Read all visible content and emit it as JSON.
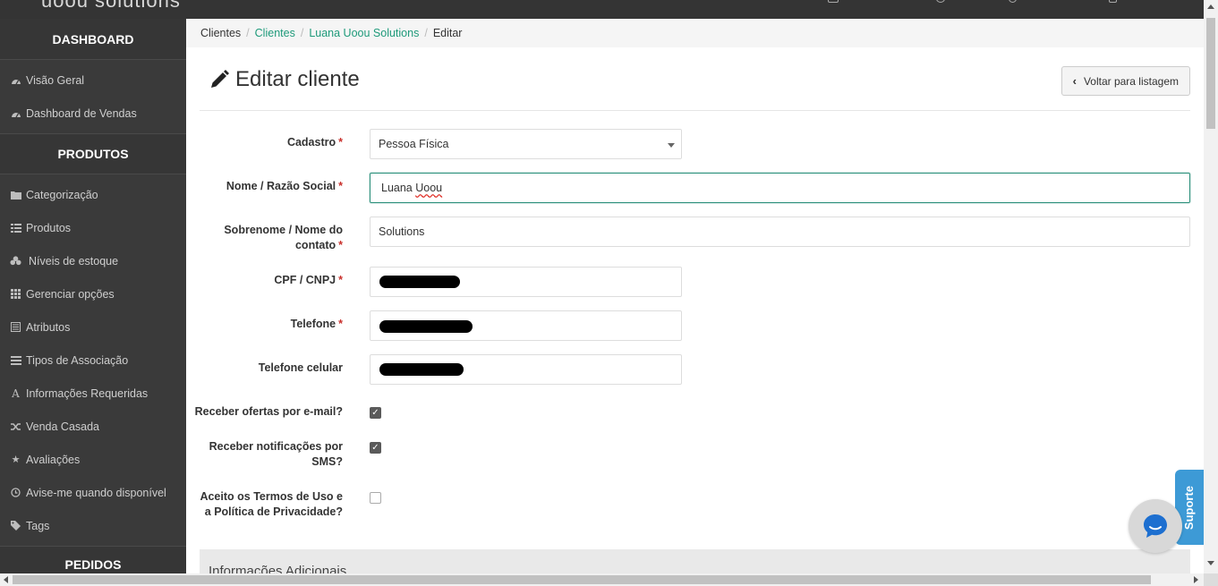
{
  "topbar": {
    "logo": "uoou solutions"
  },
  "sidebar": {
    "sections": {
      "dashboard": "DASHBOARD",
      "produtos": "PRODUTOS",
      "pedidos": "PEDIDOS"
    },
    "dashboard_items": [
      {
        "label": "Visão Geral",
        "icon": "dashboard-icon"
      },
      {
        "label": "Dashboard de Vendas",
        "icon": "dashboard-icon"
      }
    ],
    "produtos_items": [
      {
        "label": "Categorização",
        "icon": "folder-icon"
      },
      {
        "label": "Produtos",
        "icon": "list-icon"
      },
      {
        "label": "Níveis de estoque",
        "icon": "cubes-icon"
      },
      {
        "label": "Gerenciar opções",
        "icon": "grid-icon"
      },
      {
        "label": "Atributos",
        "icon": "list-alt-icon"
      },
      {
        "label": "Tipos de Associação",
        "icon": "list-icon"
      },
      {
        "label": "Informações Requeridas",
        "icon": "font-icon"
      },
      {
        "label": "Venda Casada",
        "icon": "shuffle-icon"
      },
      {
        "label": "Avaliações",
        "icon": "star-icon"
      },
      {
        "label": "Avise-me quando disponível",
        "icon": "clock-icon"
      },
      {
        "label": "Tags",
        "icon": "tag-icon"
      }
    ]
  },
  "breadcrumb": {
    "root": "Clientes",
    "link1": "Clientes",
    "link2": "Luana Uoou Solutions",
    "current": "Editar"
  },
  "page": {
    "title": "Editar cliente",
    "back_label": "Voltar para listagem"
  },
  "form": {
    "cadastro": {
      "label": "Cadastro",
      "value": "Pessoa Física"
    },
    "nome": {
      "label": "Nome / Razão Social",
      "value_first": "Luana",
      "value_second": "Uoou"
    },
    "sobrenome": {
      "label_line1": "Sobrenome / Nome do",
      "label_line2": "contato",
      "value": "Solutions"
    },
    "cpf": {
      "label": "CPF / CNPJ"
    },
    "telefone": {
      "label": "Telefone"
    },
    "celular": {
      "label": "Telefone celular"
    },
    "ofertas": {
      "label": "Receber ofertas por e-mail?",
      "checked": true
    },
    "sms": {
      "label_line1": "Receber notificações por",
      "label_line2": "SMS?",
      "checked": true
    },
    "termos": {
      "label_line1": "Aceito os Termos de Uso e",
      "label_line2": "a Política de Privacidade?",
      "checked": false
    },
    "required_mark": "*"
  },
  "info_section": {
    "title": "Informações Adicionais"
  },
  "support": {
    "label": "Suporte"
  },
  "colors": {
    "accent": "#1e9a7a",
    "sidebar": "#3a3a3a",
    "support": "#3d9ad6",
    "required": "#c9302c"
  }
}
